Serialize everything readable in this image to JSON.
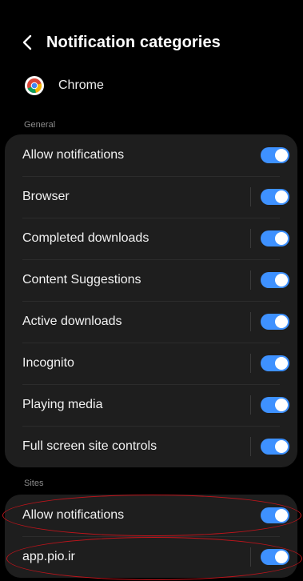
{
  "header": {
    "title": "Notification categories"
  },
  "app": {
    "name": "Chrome"
  },
  "sections": {
    "general": "General",
    "sites": "Sites"
  },
  "general_items": [
    {
      "label": "Allow notifications",
      "on": true
    },
    {
      "label": "Browser",
      "on": true
    },
    {
      "label": "Completed downloads",
      "on": true
    },
    {
      "label": "Content Suggestions",
      "on": true
    },
    {
      "label": "Active downloads",
      "on": true
    },
    {
      "label": "Incognito",
      "on": true
    },
    {
      "label": "Playing media",
      "on": true
    },
    {
      "label": "Full screen site controls",
      "on": true
    }
  ],
  "site_items": [
    {
      "label": "Allow notifications",
      "on": true
    },
    {
      "label": "app.pio.ir",
      "on": true
    }
  ],
  "colors": {
    "background": "#000000",
    "card": "#1e1e1e",
    "toggle_on": "#3e91ff",
    "annotation": "#c0141b"
  }
}
